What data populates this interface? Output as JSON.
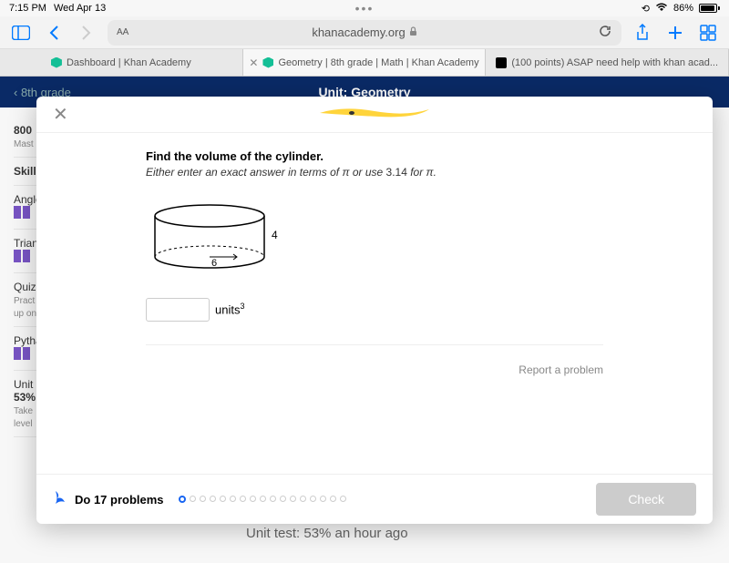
{
  "status": {
    "time": "7:15 PM",
    "date": "Wed Apr 13",
    "battery": "86%"
  },
  "safari": {
    "url": "khanacademy.org",
    "aa": "AA"
  },
  "tabs": {
    "t1": "Dashboard | Khan Academy",
    "t2": "Geometry | 8th grade | Math | Khan Academy",
    "t3": "(100 points) ASAP need help with khan acad..."
  },
  "page_header": {
    "back": "8th grade",
    "title": "Unit: Geometry"
  },
  "bg": {
    "points": "800",
    "mastery": "Mast",
    "skill": "Skill",
    "angles": "Angle",
    "trian": "Trian",
    "quiz": "Quiz",
    "pract": "Pract",
    "upon": "up on",
    "pytha": "Pytha",
    "unit": "Unit",
    "pct": "53%",
    "take": "Take",
    "level": "level",
    "unit_test": "Unit test: 53% an hour ago"
  },
  "question": {
    "title": "Find the volume of the cylinder.",
    "sub_prefix": "Either enter an exact answer in terms of ",
    "sub_mid": " or use ",
    "sub_val": "3.14",
    "sub_end": " for ",
    "pi": "π",
    "period": ".",
    "height_label": "4",
    "radius_label": "6",
    "units": "units",
    "exp": "3"
  },
  "footer": {
    "do_problems": "Do 17 problems",
    "check": "Check"
  },
  "report": "Report a problem"
}
